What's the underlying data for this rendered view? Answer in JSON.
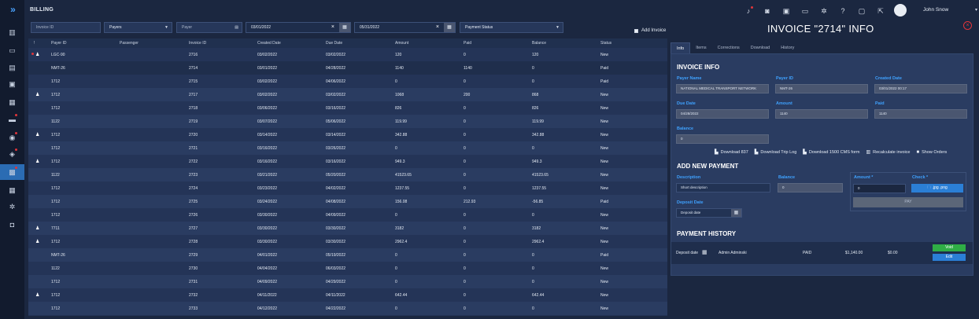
{
  "sidebar": {
    "logo": "»",
    "items": [
      "building-icon",
      "chat-icon",
      "document-icon",
      "clipboard-icon",
      "calendar-icon",
      "bus-icon",
      "users-icon",
      "location-icon",
      "briefcase-icon",
      "calendar-check-icon",
      "gear-icon",
      "shield-icon"
    ],
    "active_index": 8,
    "dots": [
      5,
      6,
      7,
      8
    ]
  },
  "header": {
    "title": "BILLING",
    "user_name": "John Snow",
    "icons": [
      "bell-icon",
      "car-icon",
      "inbox-icon",
      "message-icon",
      "settings-icon",
      "help-icon",
      "monitor-icon",
      "export-icon"
    ]
  },
  "filters": {
    "invoice_id_placeholder": "Invoice ID",
    "payers_label": "Payers",
    "payer_placeholder": "Payer",
    "date_from": "03/01/2022",
    "date_to": "05/31/2022",
    "payment_status_label": "Payment Status",
    "add_invoice_label": "Add Invoice"
  },
  "table": {
    "headers": [
      "!",
      "Payer ID",
      "Passenger",
      "Invoice ID",
      "Created Date",
      "Due Date",
      "Amount",
      "Paid",
      "Balance",
      "Status"
    ],
    "rows": [
      {
        "flag": true,
        "red": true,
        "payer": "LGC-90",
        "passenger": "",
        "invoice": "2716",
        "created": "03/02/2022",
        "due": "03/02/2022",
        "amount": "120",
        "paid": "0",
        "balance": "120",
        "status": "New"
      },
      {
        "flag": false,
        "red": false,
        "payer": "NMT-26",
        "passenger": "",
        "invoice": "2714",
        "created": "03/01/2022",
        "due": "04/28/2022",
        "amount": "1140",
        "paid": "1140",
        "balance": "0",
        "status": "Paid"
      },
      {
        "flag": false,
        "red": false,
        "payer": "1712",
        "passenger": "",
        "invoice": "2715",
        "created": "03/02/2022",
        "due": "04/06/2022",
        "amount": "0",
        "paid": "0",
        "balance": "0",
        "status": "Paid"
      },
      {
        "flag": true,
        "red": false,
        "payer": "1712",
        "passenger": "",
        "invoice": "2717",
        "created": "03/02/2022",
        "due": "03/02/2022",
        "amount": "1068",
        "paid": "200",
        "balance": "868",
        "status": "New"
      },
      {
        "flag": false,
        "red": false,
        "payer": "1712",
        "passenger": "",
        "invoice": "2718",
        "created": "03/06/2022",
        "due": "03/16/2022",
        "amount": "826",
        "paid": "0",
        "balance": "826",
        "status": "New"
      },
      {
        "flag": false,
        "red": false,
        "payer": "1122",
        "passenger": "",
        "invoice": "2719",
        "created": "03/07/2022",
        "due": "05/06/2022",
        "amount": "119.99",
        "paid": "0",
        "balance": "119.99",
        "status": "New"
      },
      {
        "flag": true,
        "red": false,
        "payer": "1712",
        "passenger": "",
        "invoice": "2720",
        "created": "03/14/2022",
        "due": "03/14/2022",
        "amount": "342.88",
        "paid": "0",
        "balance": "342.88",
        "status": "New"
      },
      {
        "flag": false,
        "red": false,
        "payer": "1712",
        "passenger": "",
        "invoice": "2721",
        "created": "03/16/2022",
        "due": "03/26/2022",
        "amount": "0",
        "paid": "0",
        "balance": "0",
        "status": "New"
      },
      {
        "flag": true,
        "red": false,
        "payer": "1712",
        "passenger": "",
        "invoice": "2722",
        "created": "03/16/2022",
        "due": "03/16/2022",
        "amount": "949.3",
        "paid": "0",
        "balance": "949.3",
        "status": "New"
      },
      {
        "flag": false,
        "red": false,
        "payer": "1122",
        "passenger": "",
        "invoice": "2723",
        "created": "03/21/2022",
        "due": "05/20/2022",
        "amount": "41523.65",
        "paid": "0",
        "balance": "41523.65",
        "status": "New"
      },
      {
        "flag": false,
        "red": false,
        "payer": "1712",
        "passenger": "",
        "invoice": "2724",
        "created": "03/23/2022",
        "due": "04/02/2022",
        "amount": "1237.55",
        "paid": "0",
        "balance": "1237.55",
        "status": "New"
      },
      {
        "flag": false,
        "red": false,
        "payer": "1712",
        "passenger": "",
        "invoice": "2725",
        "created": "03/24/2022",
        "due": "04/08/2022",
        "amount": "156.08",
        "paid": "212.93",
        "balance": "-56.85",
        "status": "Paid"
      },
      {
        "flag": false,
        "red": false,
        "payer": "1712",
        "passenger": "",
        "invoice": "2726",
        "created": "03/30/2022",
        "due": "04/09/2022",
        "amount": "0",
        "paid": "0",
        "balance": "0",
        "status": "New"
      },
      {
        "flag": true,
        "red": false,
        "payer": "7711",
        "passenger": "",
        "invoice": "2727",
        "created": "03/30/2022",
        "due": "03/30/2022",
        "amount": "3182",
        "paid": "0",
        "balance": "3182",
        "status": "New"
      },
      {
        "flag": true,
        "red": false,
        "payer": "1712",
        "passenger": "",
        "invoice": "2728",
        "created": "03/30/2022",
        "due": "03/30/2022",
        "amount": "2962.4",
        "paid": "0",
        "balance": "2962.4",
        "status": "New"
      },
      {
        "flag": false,
        "red": false,
        "payer": "NMT-26",
        "passenger": "",
        "invoice": "2729",
        "created": "04/01/2022",
        "due": "05/19/2022",
        "amount": "0",
        "paid": "0",
        "balance": "0",
        "status": "Paid"
      },
      {
        "flag": false,
        "red": false,
        "payer": "1122",
        "passenger": "",
        "invoice": "2730",
        "created": "04/04/2022",
        "due": "06/03/2022",
        "amount": "0",
        "paid": "0",
        "balance": "0",
        "status": "New"
      },
      {
        "flag": false,
        "red": false,
        "payer": "1712",
        "passenger": "",
        "invoice": "2731",
        "created": "04/09/2022",
        "due": "04/29/2022",
        "amount": "0",
        "paid": "0",
        "balance": "0",
        "status": "New"
      },
      {
        "flag": true,
        "red": false,
        "payer": "1712",
        "passenger": "",
        "invoice": "2732",
        "created": "04/11/2022",
        "due": "04/11/2022",
        "amount": "642.44",
        "paid": "0",
        "balance": "642.44",
        "status": "New"
      },
      {
        "flag": false,
        "red": false,
        "payer": "1712",
        "passenger": "",
        "invoice": "2733",
        "created": "04/12/2022",
        "due": "04/22/2022",
        "amount": "0",
        "paid": "0",
        "balance": "0",
        "status": "New"
      }
    ]
  },
  "panel": {
    "title": "INVOICE \"2714\" INFO",
    "tabs": [
      "Info",
      "Items",
      "Corrections",
      "Download",
      "History"
    ],
    "info_title": "INVOICE INFO",
    "payer_name_label": "Payer Name",
    "payer_name": "NATIONAL MEDICAL TRANSPORT NETWORK",
    "payer_id_label": "Payer ID",
    "payer_id": "NMT-26",
    "created_label": "Created Date",
    "created": "03/01/2022 00:17",
    "due_label": "Due Date",
    "due": "04/28/2022",
    "amount_label": "Amount",
    "amount": "1140",
    "paid_label": "Paid",
    "paid": "1140",
    "balance_label": "Balance",
    "balance": "0",
    "actions": [
      "Download 837",
      "Download Trip Log",
      "Download 1500 CMS form",
      "Recalculate invoice",
      "Show Orders"
    ],
    "add_payment_title": "ADD NEW PAYMENT",
    "description_label": "Description",
    "description_placeholder": "Short description",
    "pbalance_label": "Balance",
    "pbalance": "0",
    "pamount_label": "Amount *",
    "pamount": "0",
    "check_label": "Check *",
    "check_btn": ".jpg .png",
    "deposit_label": "Deposit Date",
    "deposit_placeholder": "Deposit date",
    "pay_btn": "PAY",
    "history_title": "PAYMENT HISTORY",
    "history": {
      "deposit": "Deposit date",
      "user": "Admin Adminski",
      "status": "PAID",
      "amount": "$1,140.00",
      "balance": "$0.00",
      "void": "Void",
      "edit": "Edit"
    }
  }
}
